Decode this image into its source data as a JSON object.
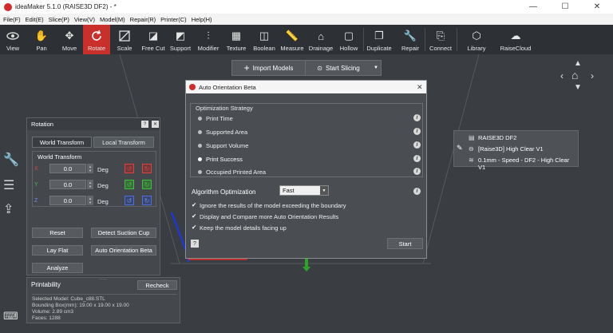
{
  "titlebar": {
    "title": "ideaMaker 5.1.0 (RAISE3D DF2) - *",
    "minimize": "—",
    "maximize": "☐",
    "close": "✕"
  },
  "menu": [
    "File(F)",
    "Edit(E)",
    "Slice(P)",
    "View(V)",
    "Model(M)",
    "Repair(R)",
    "Printer(C)",
    "Help(H)"
  ],
  "toolbar": {
    "tools": [
      {
        "label": "View",
        "icon": "eye-icon"
      },
      {
        "label": "Pan",
        "icon": "hand-icon"
      },
      {
        "label": "Move",
        "icon": "move-icon"
      },
      {
        "label": "Rotate",
        "icon": "rotate-icon"
      },
      {
        "label": "Scale",
        "icon": "scale-icon"
      },
      {
        "label": "Free Cut",
        "icon": "cut-icon"
      },
      {
        "label": "Support",
        "icon": "support-icon"
      },
      {
        "label": "Modifier",
        "icon": "modifier-icon"
      },
      {
        "label": "Texture",
        "icon": "texture-icon"
      },
      {
        "label": "Boolean",
        "icon": "boolean-icon"
      },
      {
        "label": "Measure",
        "icon": "measure-icon"
      },
      {
        "label": "Drainage",
        "icon": "drainage-icon"
      },
      {
        "label": "Hollow",
        "icon": "hollow-icon"
      },
      {
        "label": "Duplicate",
        "icon": "duplicate-icon"
      },
      {
        "label": "Repair",
        "icon": "repair-icon"
      },
      {
        "label": "Connect",
        "icon": "connect-icon"
      },
      {
        "label": "Library",
        "icon": "library-icon"
      },
      {
        "label": "RaiseCloud",
        "icon": "cloud-icon"
      }
    ]
  },
  "actionbar": {
    "import_label": "Import Models",
    "slice_label": "Start Slicing"
  },
  "rotation": {
    "title": "Rotation",
    "tab_world": "World Transform",
    "tab_local": "Local Transform",
    "group": "World Transform",
    "axes": [
      {
        "axis": "X",
        "value": "0.0",
        "unit": "Deg",
        "color": "#e04040"
      },
      {
        "axis": "Y",
        "value": "0.0",
        "unit": "Deg",
        "color": "#3fbf3f"
      },
      {
        "axis": "Z",
        "value": "0.0",
        "unit": "Deg",
        "color": "#4a6fe0"
      }
    ],
    "reset": "Reset",
    "detect": "Detect Suction Cup",
    "lay_flat": "Lay Flat",
    "auto_orient": "Auto Orientation Beta",
    "analyze": "Analyze"
  },
  "dialog": {
    "title": "Auto Orientation Beta",
    "strategy_label": "Optimization Strategy",
    "strategies": [
      "Print Time",
      "Supported Area",
      "Support Volume",
      "Print Success",
      "Occupied Printed Area"
    ],
    "selected_strategy": "Print Success",
    "algo_label": "Algorithm Optimization",
    "algo_value": "Fast",
    "checks": [
      "Ignore the results of the model exceeding the boundary",
      "Display and Compare more Auto Orientation Results",
      "Keep the model details facing up"
    ],
    "help": "?",
    "start": "Start"
  },
  "printer_info": {
    "printer": "RAISE3D DF2",
    "material": "[Raise3D] High Clear V1",
    "profile": "0.1mm - Speed - DF2 - High Clear V1"
  },
  "printability": {
    "title": "Printability",
    "recheck": "Recheck",
    "model": "Selected Model: Cube_c88.STL",
    "bbox": "Bounding Box(mm): 19.00 x 19.00 x 19.00",
    "volume": "Volume: 2.89 cm3",
    "faces": "Faces: 1288"
  },
  "colors": {
    "accent": "#c9302c",
    "toolbar": "#2d3135",
    "viewport": "#3a3e43"
  }
}
